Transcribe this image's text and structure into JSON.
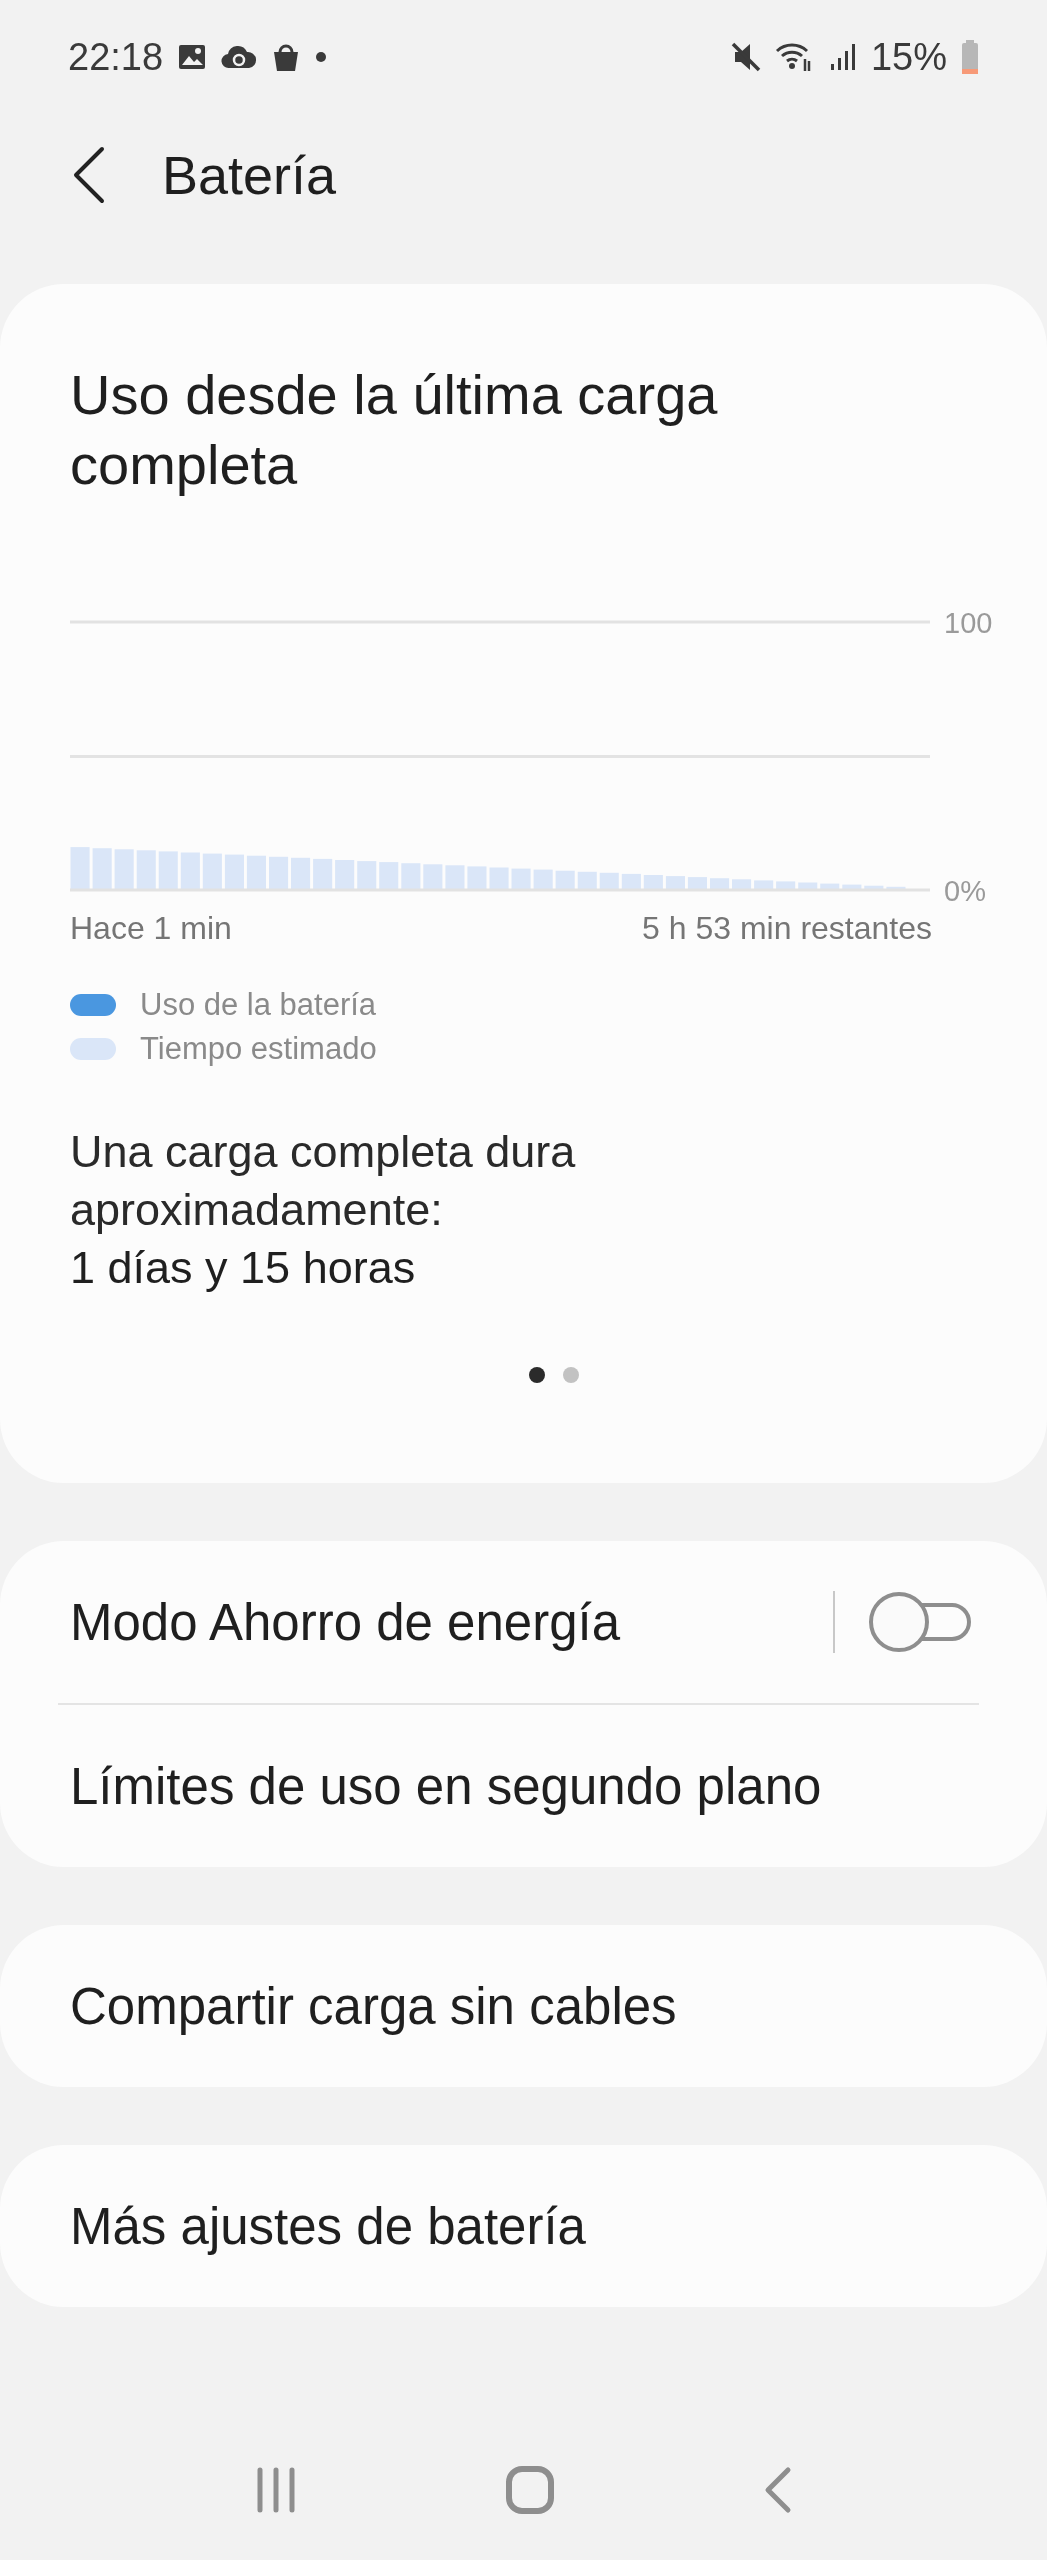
{
  "status_bar": {
    "time": "22:18",
    "battery": "15%"
  },
  "header": {
    "title": "Batería"
  },
  "usage_card": {
    "title": "Uso desde la última carga completa",
    "chart_data": {
      "type": "bar",
      "yticks": [
        {
          "value": 0,
          "label": "0%"
        },
        {
          "value": 100,
          "label": "100"
        }
      ],
      "ylim": [
        0,
        100
      ],
      "series": [
        {
          "name": "Uso de la batería",
          "color": "#4a97e0",
          "values": [
            null,
            null,
            null,
            null,
            null,
            null,
            null,
            null,
            null,
            null,
            null,
            null,
            null,
            null,
            null,
            null,
            null,
            null,
            null,
            null,
            null,
            null,
            null,
            null,
            null,
            null,
            null,
            null,
            null,
            null,
            null,
            null,
            null,
            null,
            null,
            null,
            null,
            null,
            null
          ]
        },
        {
          "name": "Tiempo estimado",
          "color": "#dae6f8",
          "values": [
            16,
            15.6,
            15.2,
            14.8,
            14.4,
            14,
            13.6,
            13.2,
            12.8,
            12.4,
            12,
            11.6,
            11.2,
            10.8,
            10.4,
            10,
            9.6,
            9.2,
            8.8,
            8.4,
            8,
            7.6,
            7.2,
            6.8,
            6.4,
            6,
            5.6,
            5.2,
            4.8,
            4.4,
            4,
            3.6,
            3.2,
            2.8,
            2.4,
            2,
            1.6,
            1.2,
            null
          ]
        }
      ]
    },
    "x_start_label": "Hace 1 min",
    "x_end_label": "5 h 53 min restantes",
    "estimate_label": "Una carga completa dura aproximadamente:",
    "estimate_value": "1 días y 15 horas",
    "pager": [
      {
        "selected": true
      },
      {
        "selected": false
      }
    ]
  },
  "groups": [
    {
      "items": [
        {
          "kind": "toggle",
          "label": "Modo Ahorro de energía",
          "on": false
        },
        {
          "kind": "link",
          "label": "Límites de uso en segundo plano"
        }
      ]
    },
    {
      "items": [
        {
          "kind": "link",
          "label": "Compartir carga sin cables"
        }
      ]
    },
    {
      "items": [
        {
          "kind": "link",
          "label": "Más ajustes de batería"
        }
      ]
    }
  ]
}
